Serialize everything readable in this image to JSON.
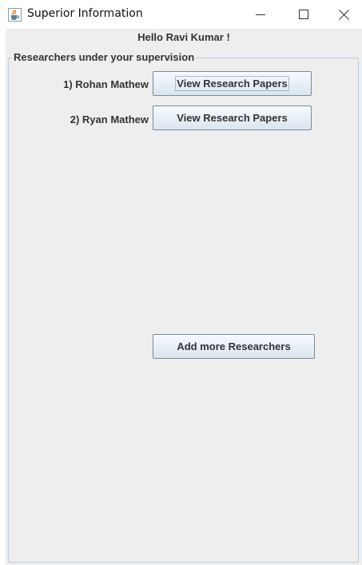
{
  "window": {
    "title": "Superior Information"
  },
  "header": {
    "greeting": "Hello Ravi Kumar !"
  },
  "panel": {
    "title": "Researchers under your supervision",
    "researchers": [
      {
        "label": "1) Rohan Mathew",
        "button": "View Research Papers"
      },
      {
        "label": "2) Ryan Mathew",
        "button": "View Research Papers"
      }
    ],
    "add_button": "Add more Researchers"
  },
  "icons": {
    "app": "java-coffee-cup-icon",
    "minimize": "minimize-icon",
    "maximize": "maximize-icon",
    "close": "close-icon"
  }
}
